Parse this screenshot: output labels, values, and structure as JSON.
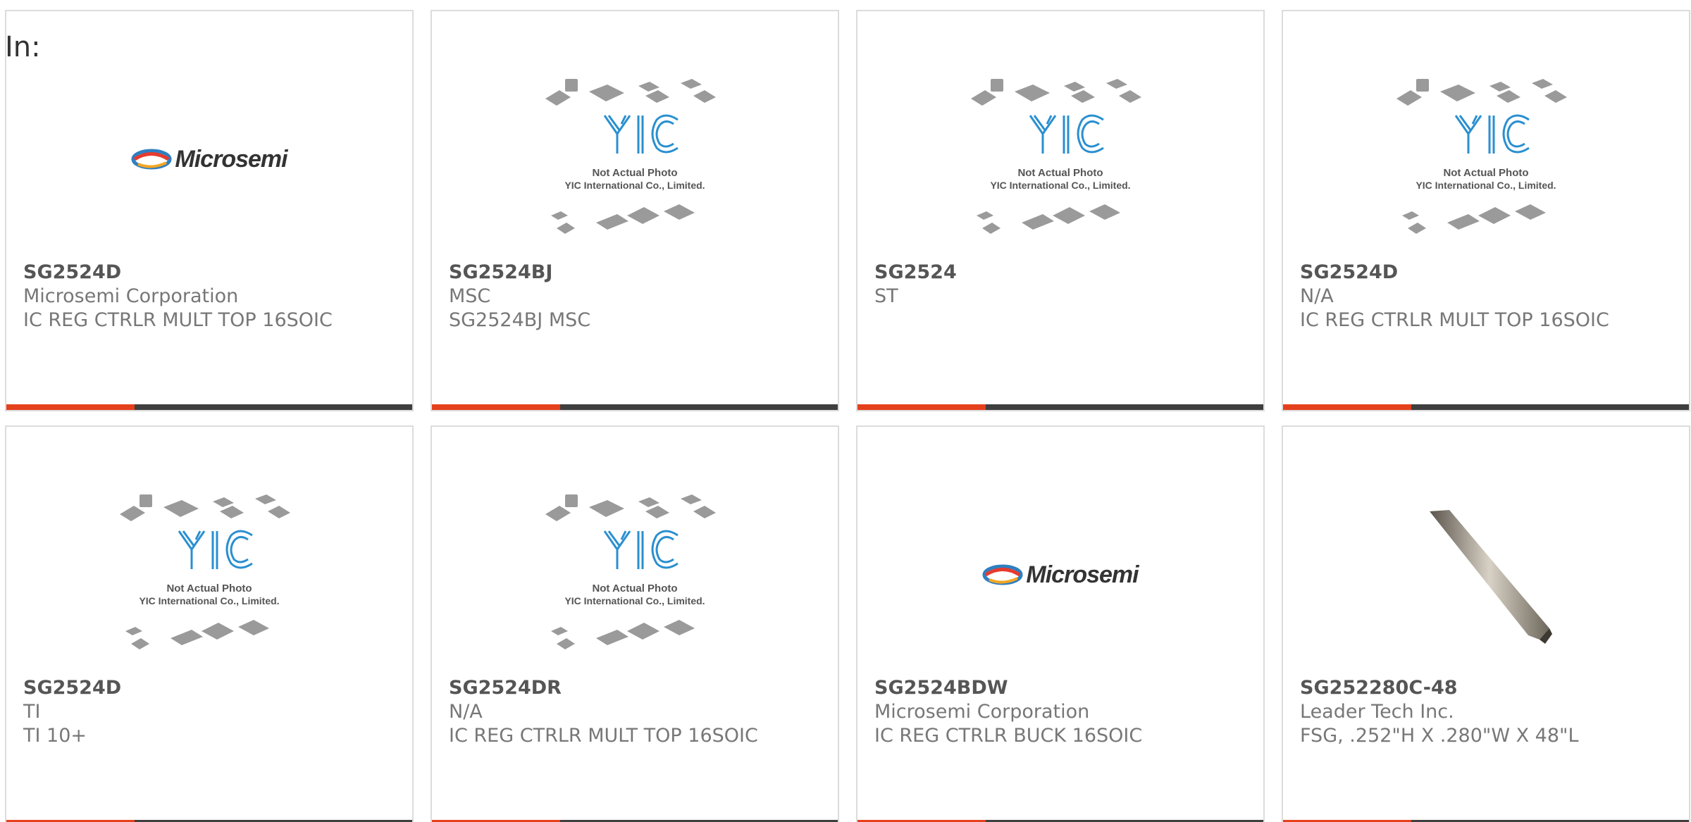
{
  "header": {
    "in_label": "In:"
  },
  "placeholder": {
    "logo_text": "YIC",
    "line1": "Not Actual Photo",
    "line2": "YIC International Co., Limited."
  },
  "brand_logo": {
    "text": "Microsemi"
  },
  "colors": {
    "accent_bar": "#e5401c",
    "dark_bar": "#3f3f3f",
    "yic_blue": "#2a8fd0"
  },
  "products": [
    {
      "part": "SG2524D",
      "maker": "Microsemi Corporation",
      "desc": "IC REG CTRLR MULT TOP 16SOIC",
      "image": "microsemi-logo"
    },
    {
      "part": "SG2524BJ",
      "maker": "MSC",
      "desc": "SG2524BJ MSC",
      "image": "yic-placeholder"
    },
    {
      "part": "SG2524",
      "maker": "ST",
      "desc": "",
      "image": "yic-placeholder"
    },
    {
      "part": "SG2524D",
      "maker": "N/A",
      "desc": "IC REG CTRLR MULT TOP 16SOIC",
      "image": "yic-placeholder"
    },
    {
      "part": "SG2524D",
      "maker": "TI",
      "desc": "TI 10+",
      "image": "yic-placeholder"
    },
    {
      "part": "SG2524DR",
      "maker": "N/A",
      "desc": "IC REG CTRLR MULT TOP 16SOIC",
      "image": "yic-placeholder"
    },
    {
      "part": "SG2524BDW",
      "maker": "Microsemi Corporation",
      "desc": "IC REG CTRLR BUCK 16SOIC",
      "image": "microsemi-logo"
    },
    {
      "part": "SG252280C-48",
      "maker": "Leader Tech Inc.",
      "desc": "FSG, .252\"H X .280\"W X 48\"L",
      "image": "metal-strip-photo"
    }
  ]
}
